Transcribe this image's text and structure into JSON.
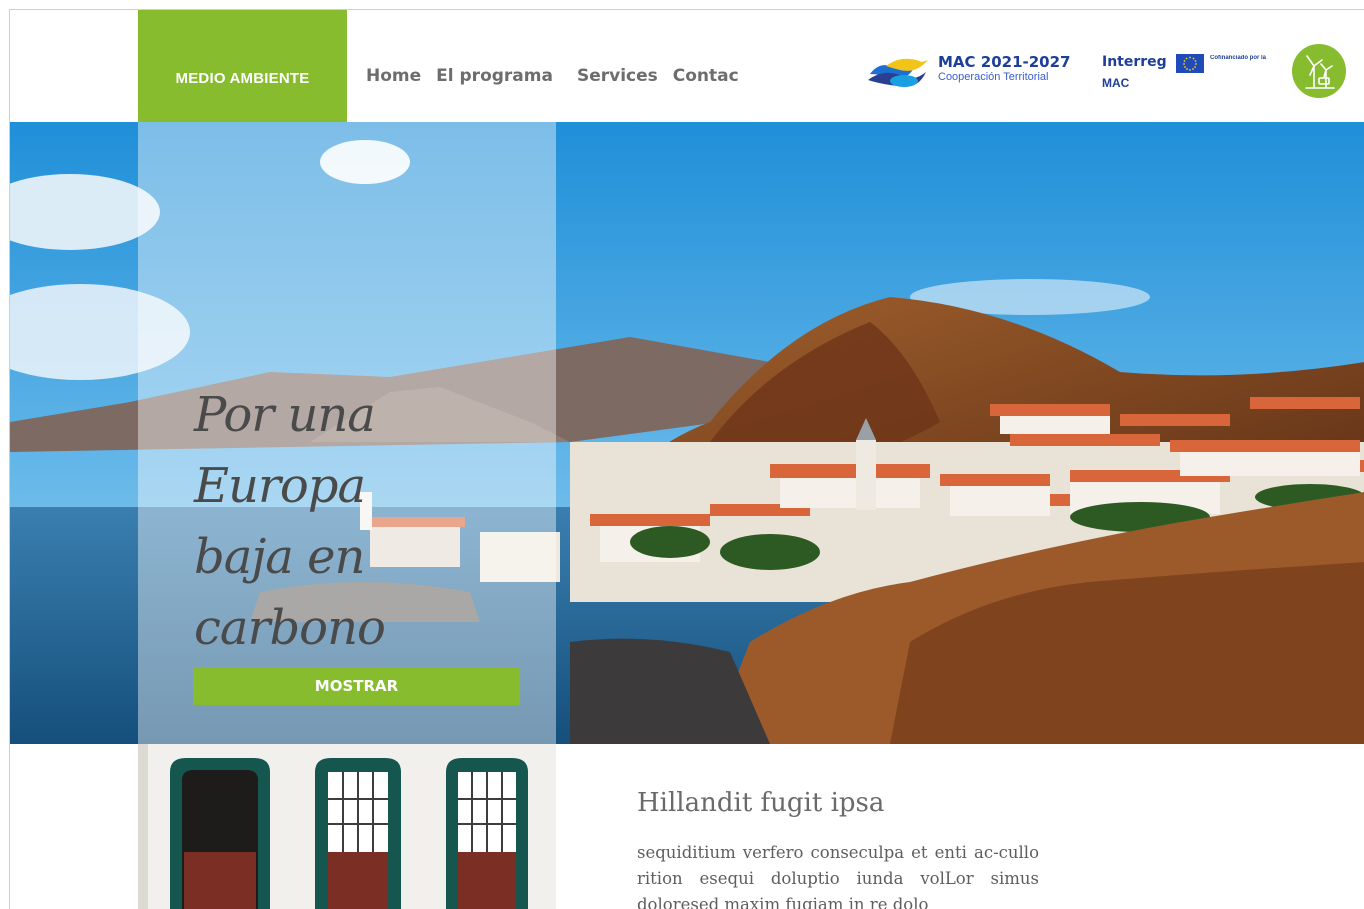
{
  "header": {
    "brand_label": "MEDIO AMBIENTE",
    "nav": [
      {
        "label": "Home"
      },
      {
        "label": "El programa"
      },
      {
        "label": "Services"
      },
      {
        "label": "Contac"
      }
    ],
    "logos": {
      "mac_title": "MAC 2021-2027",
      "mac_subtitle": "Cooperación Territorial",
      "interreg_word": "Interreg",
      "interreg_region": "MAC",
      "eu_text": "Cofinanciado por la Unión Europea"
    }
  },
  "hero": {
    "headline_lines": [
      "Por una",
      "Europa",
      "baja en",
      "carbono"
    ],
    "cta_label": "MOSTRAR"
  },
  "content": {
    "title": "Hillandit fugit ipsa",
    "body": "sequiditium verfero conseculpa et enti ac-cullo rition esequi doluptio iunda volLor simus doloresed maxim fugiam in re dolo"
  },
  "colors": {
    "accent_green": "#86bc2e",
    "text_gray": "#6d6d6d",
    "mac_blue": "#1d3f9a"
  },
  "icons": [
    "wind-turbine-icon",
    "eu-flag-icon",
    "mac-wave-logo"
  ]
}
